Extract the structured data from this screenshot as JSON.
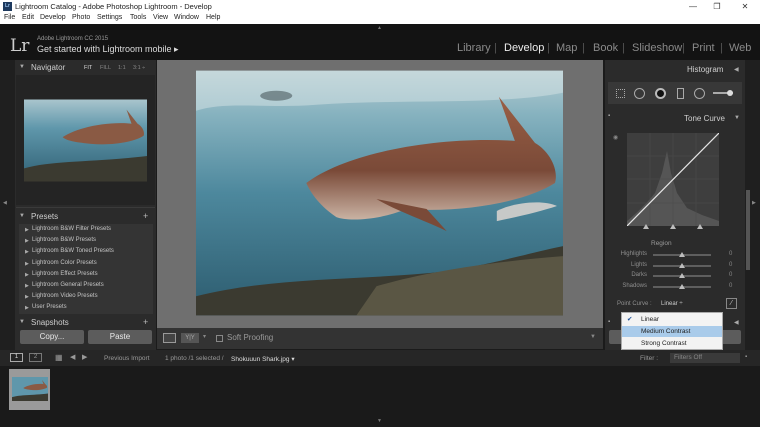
{
  "window": {
    "title": "Lightroom Catalog - Adobe Photoshop Lightroom - Develop",
    "app_icon_text": "Lr",
    "minimize_glyph": "—",
    "maximize_glyph": "❐",
    "close_glyph": "✕"
  },
  "menu": [
    "File",
    "Edit",
    "Develop",
    "Photo",
    "Settings",
    "Tools",
    "View",
    "Window",
    "Help"
  ],
  "identity": {
    "logo": "Lr",
    "product": "Adobe Lightroom CC 2015",
    "mobile_link": "Get started with Lightroom mobile ▸"
  },
  "modules": [
    "Library",
    "Develop",
    "Map",
    "Book",
    "Slideshow",
    "Print",
    "Web"
  ],
  "module_separator": "|",
  "active_module": "Develop",
  "navigator": {
    "title": "Navigator",
    "zoom": [
      "FIT",
      "FILL",
      "1:1",
      "3:1 ÷"
    ]
  },
  "presets": {
    "title": "Presets",
    "add": "+",
    "items": [
      "Lightroom B&W Filter Presets",
      "Lightroom B&W Presets",
      "Lightroom B&W Toned Presets",
      "Lightroom Color Presets",
      "Lightroom Effect Presets",
      "Lightroom General Presets",
      "Lightroom Video Presets",
      "User Presets"
    ]
  },
  "snapshots": {
    "title": "Snapshots",
    "add": "+"
  },
  "left_buttons": {
    "copy": "Copy...",
    "paste": "Paste"
  },
  "toolbar": {
    "view_mode": "Y|Y",
    "soft_proofing": "Soft Proofing"
  },
  "histogram": {
    "title": "Histogram"
  },
  "tone_curve": {
    "title": "Tone Curve",
    "region_title": "Region",
    "sliders": [
      {
        "label": "Highlights",
        "value": "0",
        "level": 0.5
      },
      {
        "label": "Lights",
        "value": "0",
        "level": 0.5
      },
      {
        "label": "Darks",
        "value": "0",
        "level": 0.5
      },
      {
        "label": "Shadows",
        "value": "0",
        "level": 0.5
      }
    ],
    "point_curve_label": "Point Curve :",
    "point_curve_value": "Linear ÷",
    "point_curve_options": [
      {
        "label": "Linear",
        "checked": true,
        "highlighted": false
      },
      {
        "label": "Medium Contrast",
        "checked": false,
        "highlighted": true
      },
      {
        "label": "Strong Contrast",
        "checked": false,
        "highlighted": false
      }
    ],
    "check_glyph": "✔"
  },
  "filmstrip": {
    "monitor_1": "1",
    "monitor_2": "2",
    "source": "Previous Import",
    "info_prefix": "1 photo /1 selected /",
    "filename": "Shokuuun Shark.jpg ▾",
    "filter_label": "Filter :",
    "filter_value": "Filters Off"
  },
  "colors": {
    "background": "#1b1b1b",
    "panel": "#2b2b2b",
    "canvas": "#6f6f6f",
    "dropdown_highlight": "#a9cbea"
  }
}
